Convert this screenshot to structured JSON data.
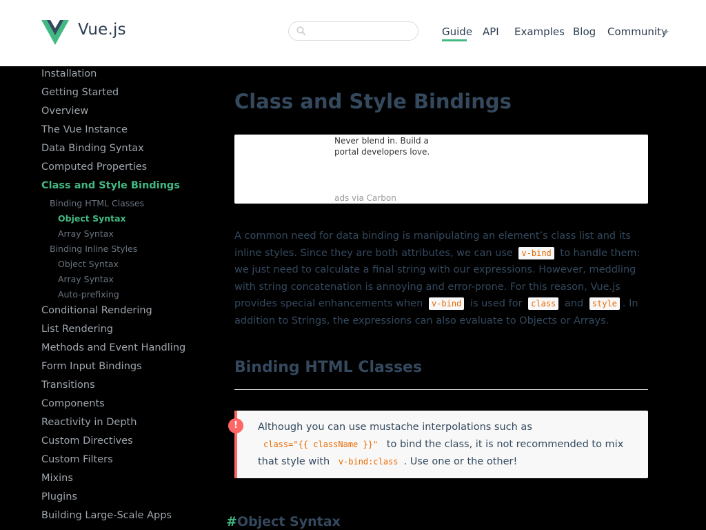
{
  "header": {
    "brand": "Vue.js",
    "search_placeholder": "",
    "nav": [
      {
        "label": "Guide",
        "active": true
      },
      {
        "label": "API"
      },
      {
        "label": "Examples"
      },
      {
        "label": "Blog"
      },
      {
        "label": "Community"
      }
    ]
  },
  "colors": {
    "accent": "#42b983",
    "text": "#34495e",
    "warning": "#ff6666",
    "code": "#e96900"
  },
  "icons": {
    "logo": "vue-logo-icon",
    "search": "search-icon",
    "dropdown": "chevron-down-icon",
    "warning": "exclamation-icon"
  },
  "sidebar": {
    "items_top": [
      "Installation",
      "Getting Started",
      "Overview",
      "The Vue Instance",
      "Data Binding Syntax",
      "Computed Properties"
    ],
    "active_item": "Class and Style Bindings",
    "sub_items": [
      {
        "label": "Binding HTML Classes",
        "level": 1
      },
      {
        "label": "Object Syntax",
        "level": 2,
        "active": true
      },
      {
        "label": "Array Syntax",
        "level": 2
      },
      {
        "label": "Binding Inline Styles",
        "level": 1
      },
      {
        "label": "Object Syntax",
        "level": 2
      },
      {
        "label": "Array Syntax",
        "level": 2
      },
      {
        "label": "Auto-prefixing",
        "level": 2
      }
    ],
    "items_bottom": [
      "Conditional Rendering",
      "List Rendering",
      "Methods and Event Handling",
      "Form Input Bindings",
      "Transitions",
      "Components",
      "Reactivity in Depth",
      "Custom Directives",
      "Custom Filters",
      "Mixins",
      "Plugins",
      "Building Large-Scale Apps"
    ]
  },
  "main": {
    "title": "Class and Style Bindings",
    "ad": {
      "text": "Never blend in. Build a portal developers love.",
      "via": "ads via Carbon"
    },
    "intro": {
      "t1": "A common need for data binding is manipulating an element’s class list and its inline styles. Since they are both attributes, we can use",
      "c1": "v-bind",
      "t2": "to handle them: we just need to calculate a final string with our expressions. However, meddling with string concatenation is annoying and error-prone. For this reason, Vue.js provides special enhancements when",
      "c2": "v-bind",
      "t3": "is used for",
      "c3": "class",
      "t4": "and",
      "c4": "style",
      "t5": ". In addition to Strings, the expressions can also evaluate to Objects or Arrays."
    },
    "section_title": "Binding HTML Classes",
    "tip": {
      "t1": "Although you can use mustache interpolations such as",
      "c1": "class=\"{{ className }}\"",
      "t2": "to bind the class, it is not recommended to mix that style with",
      "c2": "v-bind:class",
      "t3": ". Use one or the other!"
    },
    "subsection": {
      "hash": "#",
      "title": "Object Syntax"
    }
  }
}
